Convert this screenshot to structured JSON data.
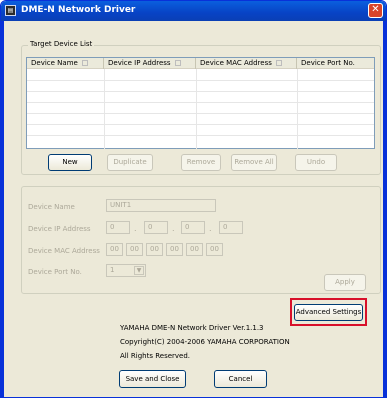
{
  "window": {
    "title": "DME-N Network Driver",
    "close_glyph": "✕",
    "icon_glyph": "▤"
  },
  "target_device_list": {
    "group_label": "Target Device List",
    "columns": [
      "Device Name",
      "Device IP Address",
      "Device MAC Address",
      "Device Port No."
    ],
    "buttons": {
      "new": "New",
      "duplicate": "Duplicate",
      "remove": "Remove",
      "remove_all": "Remove All",
      "undo": "Undo"
    }
  },
  "device_settings": {
    "device_name_label": "Device Name",
    "device_name_value": "UNIT1",
    "ip_label": "Device IP Address",
    "ip_octets": [
      "0",
      "0",
      "0",
      "0"
    ],
    "mac_label": "Device MAC Address",
    "mac_octets": [
      "00",
      "00",
      "00",
      "00",
      "00",
      "00"
    ],
    "port_label": "Device Port No.",
    "port_value": "1",
    "apply_label": "Apply"
  },
  "footer": {
    "advanced_settings_label": "Advanced Settings",
    "version_text": "YAMAHA DME-N Network Driver Ver.1.1.3",
    "copyright_text": "Copyright(C) 2004-2006 YAMAHA CORPORATION",
    "rights_text": "All Rights Reserved.",
    "save_close_label": "Save and Close",
    "cancel_label": "Cancel"
  },
  "colors": {
    "titlebar": "#0a5fde",
    "highlight": "#d8102a",
    "window_bg": "#ece9d8"
  }
}
